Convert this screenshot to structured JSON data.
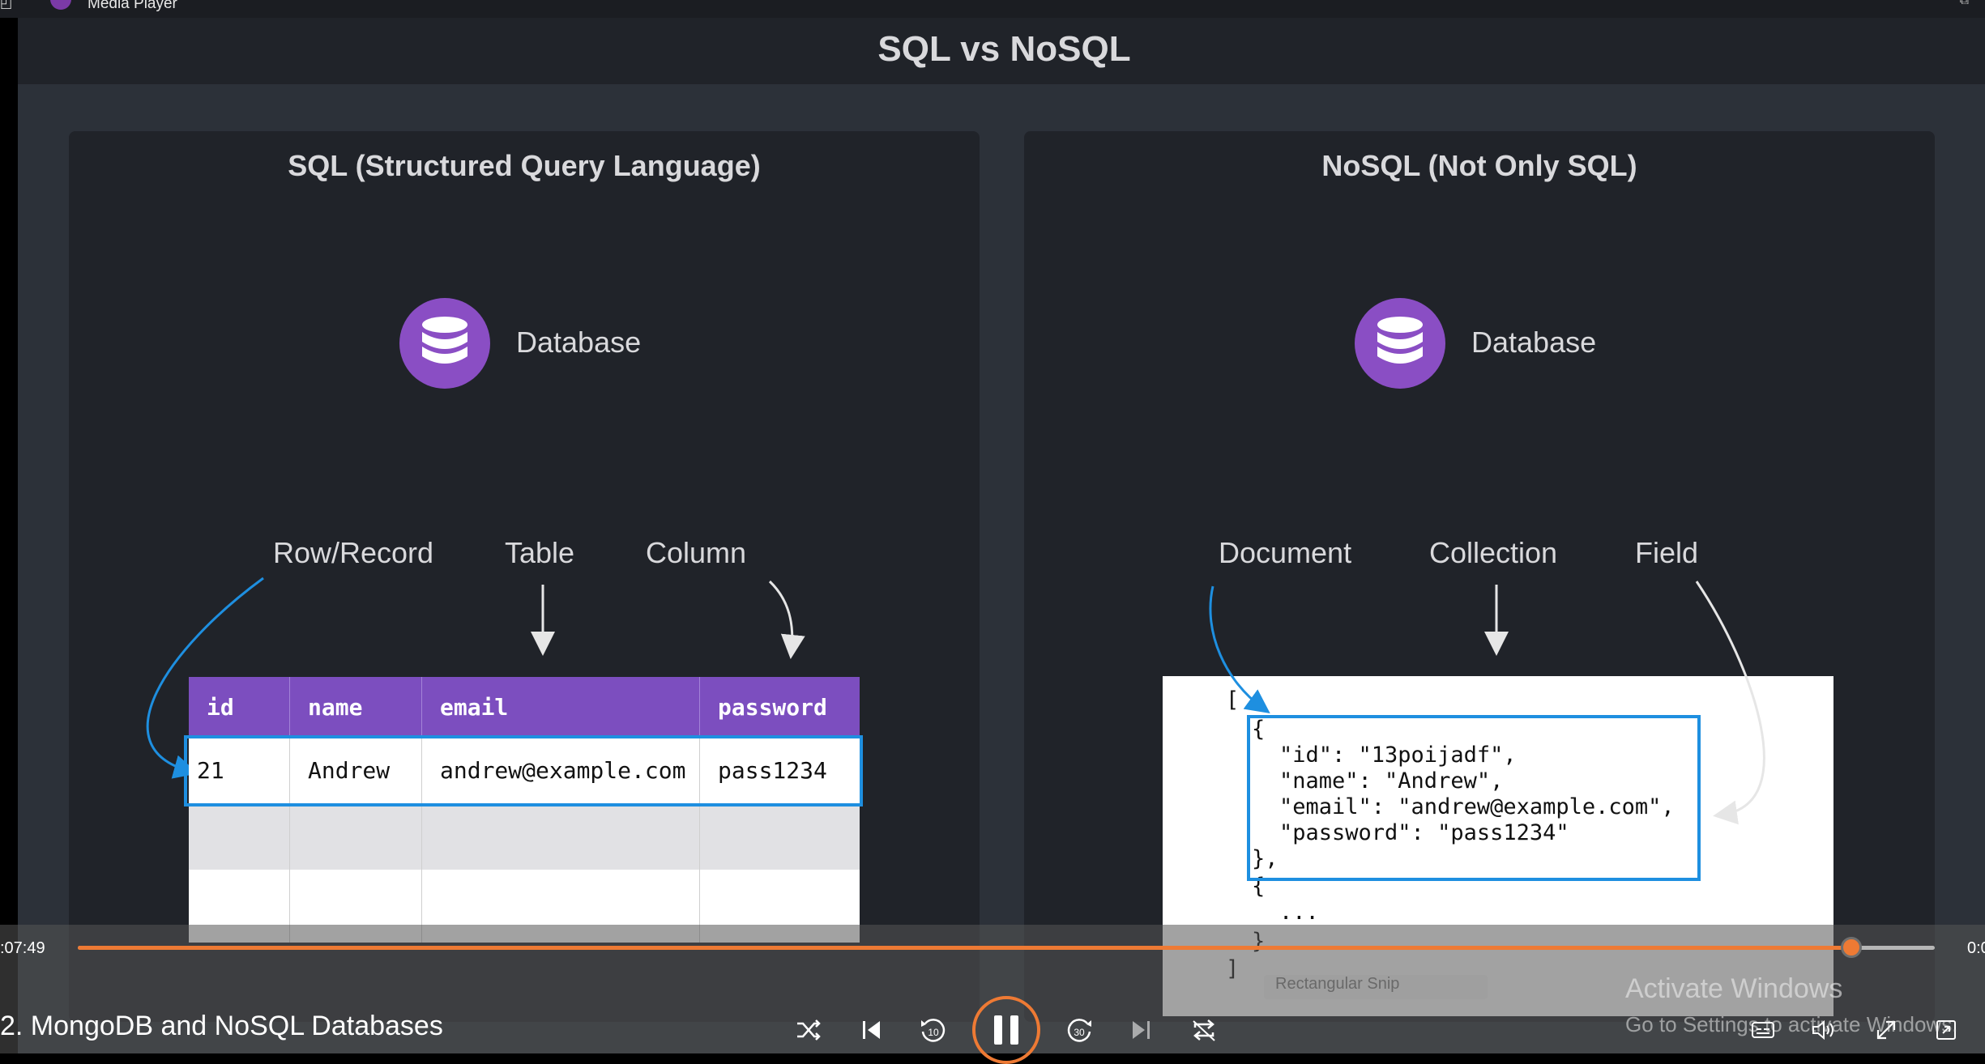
{
  "titlebar": {
    "app_name": "Media Player"
  },
  "slide": {
    "title": "SQL vs NoSQL",
    "sql": {
      "panel_title": "SQL (Structured Query Language)",
      "db_label": "Database",
      "callouts": {
        "row": "Row/Record",
        "table": "Table",
        "column": "Column"
      },
      "table": {
        "headers": [
          "id",
          "name",
          "email",
          "password"
        ],
        "row": [
          "21",
          "Andrew",
          "andrew@example.com",
          "pass1234"
        ]
      }
    },
    "nosql": {
      "panel_title": "NoSQL (Not Only SQL)",
      "db_label": "Database",
      "callouts": {
        "document": "Document",
        "collection": "Collection",
        "field": "Field"
      },
      "json": {
        "open_bracket": "[",
        "open_brace": "{",
        "id_line": "\"id\": \"13poijadf\",",
        "name_line": "\"name\": \"Andrew\",",
        "email_line": "\"email\": \"andrew@example.com\",",
        "password_line": "\"password\": \"pass1234\"",
        "close_brace": "},",
        "open_brace2": "{",
        "ellipsis": "...",
        "close_brace2": "}",
        "close_bracket": "]"
      }
    }
  },
  "player": {
    "time_elapsed": ":07:49",
    "time_remaining": "0:0",
    "progress": 0.955,
    "video_title": "2. MongoDB and NoSQL Databases",
    "accent": "#ee7a34"
  },
  "overlay": {
    "watermark_title": "Activate Windows",
    "watermark_sub": "Go to Settings to activate Windows.",
    "snip_label": "Rectangular Snip"
  }
}
